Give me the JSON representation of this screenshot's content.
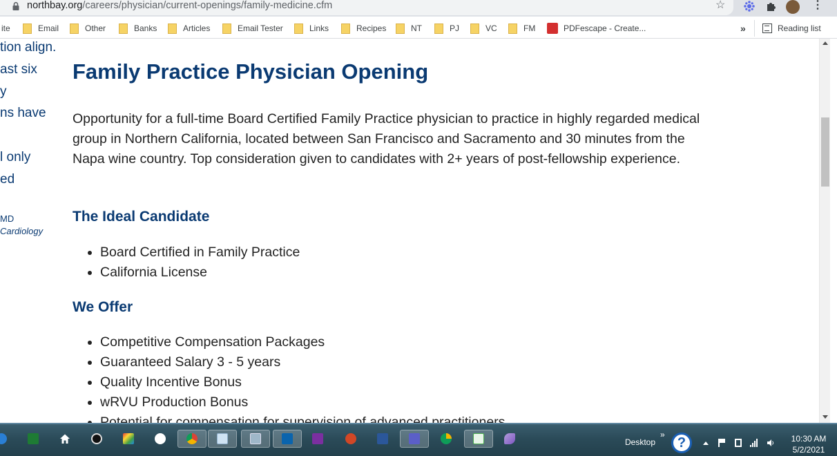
{
  "browser": {
    "url_host": "northbay.org",
    "url_path": "/careers/physician/current-openings/family-medicine.cfm",
    "bookmarks": [
      {
        "label": "ite",
        "icon": "folder-icon"
      },
      {
        "label": "Email",
        "icon": "folder-icon"
      },
      {
        "label": "Other",
        "icon": "folder-icon"
      },
      {
        "label": "Banks",
        "icon": "folder-icon"
      },
      {
        "label": "Articles",
        "icon": "folder-icon"
      },
      {
        "label": "Email Tester",
        "icon": "folder-icon"
      },
      {
        "label": "Links",
        "icon": "folder-icon"
      },
      {
        "label": "Recipes",
        "icon": "folder-icon"
      },
      {
        "label": "NT",
        "icon": "folder-icon"
      },
      {
        "label": "PJ",
        "icon": "folder-icon"
      },
      {
        "label": "VC",
        "icon": "folder-icon"
      },
      {
        "label": "FM",
        "icon": "folder-icon"
      },
      {
        "label": "PDFescape - Create...",
        "icon": "pdfescape-icon"
      }
    ],
    "overflow": "»",
    "reading_list": "Reading list"
  },
  "sidebar_fragments": [
    "tion align.",
    "ast six",
    "y",
    "ns have",
    "l only",
    "ed"
  ],
  "sidebar_sig": {
    "name": "MD",
    "dept": "Cardiology"
  },
  "page": {
    "title": "Family Practice Physician Opening",
    "intro": "Opportunity for a full-time Board Certified Family Practice physician to practice in highly regarded medical group in Northern California, located between San Francisco and Sacramento and 30 minutes from the Napa wine country.  Top consideration given to candidates with 2+ years of post-fellowship experience.",
    "sections": [
      {
        "heading": "The Ideal Candidate",
        "items": [
          "Board Certified in Family Practice",
          "California License"
        ]
      },
      {
        "heading": "We Offer",
        "items": [
          "Competitive Compensation Packages",
          "Guaranteed Salary 3 - 5 years",
          "Quality Incentive Bonus",
          "wRVU Production Bonus",
          "Potential for compensation for supervision of advanced practitioners"
        ]
      }
    ]
  },
  "taskbar": {
    "desktop_label": "Desktop",
    "desktop_chevron": "»",
    "help": "?",
    "time": "10:30 AM",
    "date": "5/2/2021"
  }
}
